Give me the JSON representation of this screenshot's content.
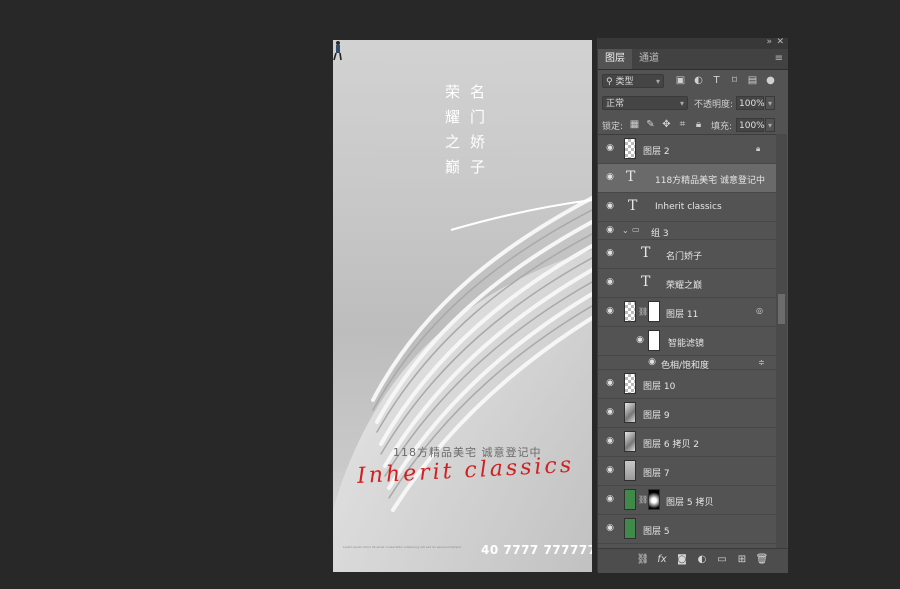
{
  "poster": {
    "col_right": "名门娇子",
    "col_left": "荣耀之巅",
    "subtitle": "118方精品美宅  诚意登记中",
    "script_text": "Inherit classics",
    "phone": "40 7777 777777",
    "fine_print": "Lorem ipsum dolor sit amet consectetur adipiscing elit sed do eiusmod tempor"
  },
  "panel": {
    "tabs": [
      "图层",
      "通道"
    ],
    "filter_kind": "类型",
    "blend_mode": "正常",
    "opacity_label": "不透明度:",
    "opacity_value": "100%",
    "lock_label": "锁定:",
    "fill_label": "填充:",
    "fill_value": "100%",
    "layers": {
      "l0": "图层 2",
      "l1": "118方精品美宅  诚意登记中",
      "l2": "Inherit classics",
      "l3": "组 3",
      "l4": "名门娇子",
      "l5": "荣耀之巅",
      "l6": "图层 11",
      "l7": "智能滤镜",
      "l8": "色相/饱和度",
      "l9": "图层 10",
      "l10": "图层 9",
      "l11": "图层 6 拷贝 2",
      "l12": "图层 7",
      "l13": "图层 5 拷贝",
      "l14": "图层 5"
    }
  },
  "colors": {
    "accent_script": "#d02020",
    "panel_bg": "#535353",
    "workspace_bg": "#282828",
    "layer_green": "#3f8a4a"
  }
}
